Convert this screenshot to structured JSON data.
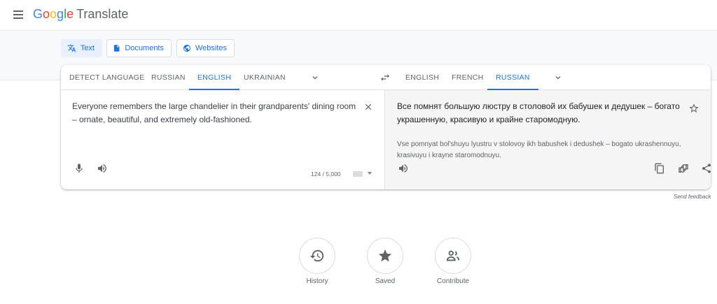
{
  "app": {
    "logo_letters": [
      "G",
      "o",
      "o",
      "g",
      "l",
      "e"
    ],
    "product": "Translate"
  },
  "modes": [
    {
      "label": "Text",
      "icon": "translate-icon",
      "active": true
    },
    {
      "label": "Documents",
      "icon": "document-icon",
      "active": false
    },
    {
      "label": "Websites",
      "icon": "globe-icon",
      "active": false
    }
  ],
  "source_langs": [
    {
      "label": "DETECT LANGUAGE",
      "active": false
    },
    {
      "label": "RUSSIAN",
      "active": false
    },
    {
      "label": "ENGLISH",
      "active": true
    },
    {
      "label": "UKRAINIAN",
      "active": false
    }
  ],
  "target_langs": [
    {
      "label": "ENGLISH",
      "active": false
    },
    {
      "label": "FRENCH",
      "active": false
    },
    {
      "label": "RUSSIAN",
      "active": true
    }
  ],
  "source": {
    "text": "Everyone remembers the large chandelier in their grandparents' dining room – ornate, beautiful, and extremely old-fashioned.",
    "counter": "124 / 5,000"
  },
  "target": {
    "text": "Все помнят большую люстру в столовой их бабушек и дедушек – богато украшенную, красивую и крайне старомодную.",
    "transliteration": "Vse pomnyat bol'shuyu lyustru v stolovoy ikh babushek i dedushek – bogato ukrashennuyu, krasivuyu i krayne staromodnuyu."
  },
  "feedback": "Send feedback",
  "actions": [
    {
      "label": "History",
      "icon": "history-icon"
    },
    {
      "label": "Saved",
      "icon": "star-icon"
    },
    {
      "label": "Contribute",
      "icon": "people-icon"
    }
  ],
  "colors": {
    "accent": "#1a73e8",
    "active_bg": "#e8f0fe",
    "target_bg": "#f5f5f5"
  }
}
